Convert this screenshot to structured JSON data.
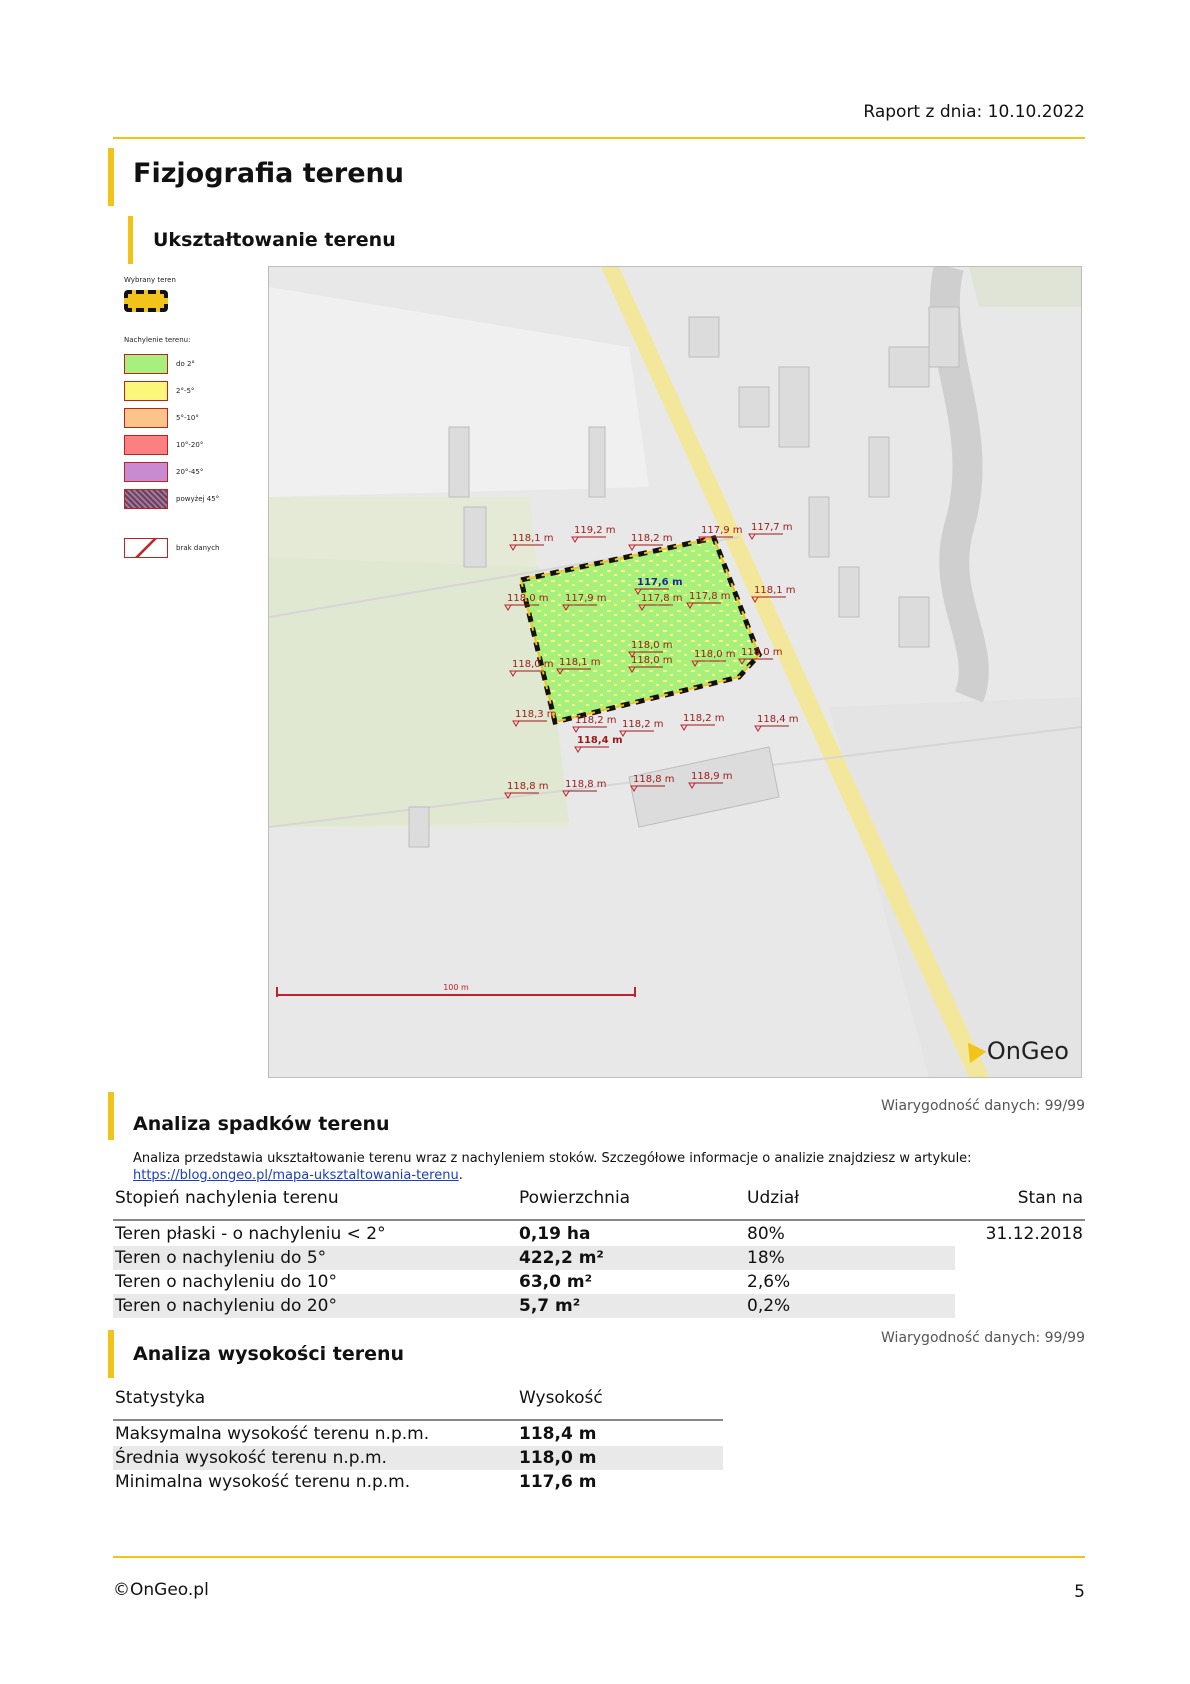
{
  "header": {
    "report_date": "Raport z dnia: 10.10.2022"
  },
  "section": {
    "title": "Fizjografia terenu",
    "subtitle": "Ukształtowanie terenu"
  },
  "legend": {
    "selected_heading": "Wybrany teren",
    "slope_heading": "Nachylenie terenu:",
    "items": [
      {
        "label": "do 2°",
        "color": "#a8f07e"
      },
      {
        "label": "2°-5°",
        "color": "#fbf77a"
      },
      {
        "label": "5°-10°",
        "color": "#fbc58a"
      },
      {
        "label": "10°-20°",
        "color": "#fb8080"
      },
      {
        "label": "20°-45°",
        "color": "#c88ad0"
      },
      {
        "label": "powyżej 45°",
        "color": "#6a4060"
      }
    ],
    "nodata_label": "brak danych"
  },
  "map": {
    "scale_label": "100 m",
    "brand": "OnGeo",
    "elevations": [
      "118,1 m",
      "119,2 m",
      "118,2 m",
      "117,9 m",
      "117,7 m",
      "118,0 m",
      "117,9 m",
      "117,6 m",
      "117,8 m",
      "117,8 m",
      "118,1 m",
      "118,0 m",
      "118,1 m",
      "118,0 m",
      "118,0 m",
      "118,0 m",
      "118,0 m",
      "118,3 m",
      "118,2 m",
      "118,2 m",
      "118,2 m",
      "118,4 m",
      "118,4 m",
      "118,8 m",
      "118,8 m",
      "118,8 m",
      "118,9 m"
    ]
  },
  "slopes": {
    "title": "Analiza spadków terenu",
    "reliability": "Wiarygodność danych: 99/99",
    "description": "Analiza przedstawia ukształtowanie terenu wraz z nachyleniem stoków. Szczegółowe informacje o analizie znajdziesz w artykule:",
    "link": "https://blog.ongeo.pl/mapa-uksztaltowania-terenu",
    "link_suffix": ".",
    "columns": [
      "Stopień nachylenia terenu",
      "Powierzchnia",
      "Udział",
      "Stan na"
    ],
    "rows": [
      {
        "name": "Teren płaski - o nachyleniu < 2°",
        "area": "0,19 ha",
        "share": "80%",
        "date": "31.12.2018"
      },
      {
        "name": "Teren o nachyleniu do 5°",
        "area": "422,2 m²",
        "share": "18%",
        "date": ""
      },
      {
        "name": "Teren o nachyleniu do 10°",
        "area": "63,0 m²",
        "share": "2,6%",
        "date": ""
      },
      {
        "name": "Teren o nachyleniu do 20°",
        "area": "5,7 m²",
        "share": "0,2%",
        "date": ""
      }
    ]
  },
  "heights": {
    "title": "Analiza wysokości terenu",
    "reliability": "Wiarygodność danych: 99/99",
    "columns": [
      "Statystyka",
      "Wysokość"
    ],
    "rows": [
      {
        "name": "Maksymalna wysokość terenu n.p.m.",
        "value": "118,4 m"
      },
      {
        "name": "Średnia wysokość terenu n.p.m.",
        "value": "118,0 m"
      },
      {
        "name": "Minimalna wysokość terenu n.p.m.",
        "value": "117,6 m"
      }
    ]
  },
  "footer": {
    "copyright": "©OnGeo.pl",
    "page": "5"
  }
}
